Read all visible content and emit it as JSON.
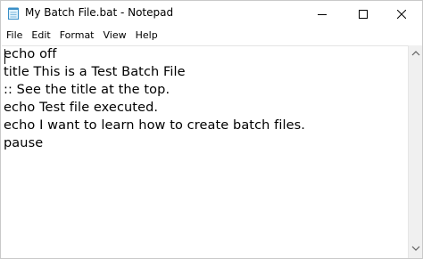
{
  "window": {
    "title": "My Batch File.bat - Notepad",
    "icon": "notepad-icon"
  },
  "controls": {
    "minimize_icon": "minimize-icon",
    "maximize_icon": "maximize-icon",
    "close_icon": "close-icon"
  },
  "menu": {
    "items": [
      "File",
      "Edit",
      "Format",
      "View",
      "Help"
    ]
  },
  "editor": {
    "lines": [
      "echo off",
      "title This is a Test Batch File",
      ":: See the title at the top.",
      "echo Test file executed.",
      "echo I want to learn how to create batch files.",
      "pause"
    ]
  },
  "scrollbar": {
    "up_icon": "scroll-up-arrow-icon",
    "down_icon": "scroll-down-arrow-icon"
  }
}
